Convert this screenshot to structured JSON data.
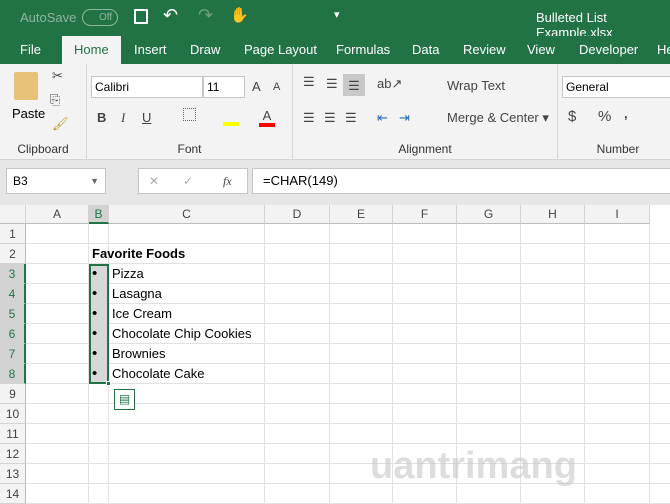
{
  "title_bar": {
    "autosave_label": "AutoSave",
    "autosave_state": "Off",
    "filename": "Bulleted List Example.xlsx"
  },
  "tabs": [
    "File",
    "Home",
    "Insert",
    "Draw",
    "Page Layout",
    "Formulas",
    "Data",
    "Review",
    "View",
    "Developer",
    "He"
  ],
  "ribbon": {
    "clipboard": {
      "paste": "Paste",
      "label": "Clipboard"
    },
    "font": {
      "name": "Calibri",
      "size": "11",
      "bold": "B",
      "italic": "I",
      "underline": "U",
      "label": "Font",
      "highlight_color": "#ffff00",
      "font_color": "#ff0000"
    },
    "alignment": {
      "wrap_text": "Wrap Text",
      "merge_center": "Merge & Center",
      "label": "Alignment"
    },
    "number": {
      "format": "General",
      "currency": "$",
      "percent": "%",
      "comma": ",",
      "label": "Number"
    }
  },
  "formula_bar": {
    "name_box": "B3",
    "cancel": "✕",
    "enter": "✓",
    "fx": "fx",
    "formula": "=CHAR(149)"
  },
  "columns": [
    "A",
    "B",
    "C",
    "D",
    "E",
    "F",
    "G",
    "H",
    "I"
  ],
  "rows": [
    "1",
    "2",
    "3",
    "4",
    "5",
    "6",
    "7",
    "8",
    "9",
    "10",
    "11",
    "12",
    "13",
    "14"
  ],
  "cells": {
    "C2": "Favorite Foods",
    "bullets": [
      "•",
      "•",
      "•",
      "•",
      "•",
      "•"
    ],
    "items": [
      "Pizza",
      "Lasagna",
      "Ice Cream",
      "Chocolate Chip Cookies",
      "Brownies",
      "Chocolate Cake"
    ]
  },
  "watermark": "uantrimang"
}
